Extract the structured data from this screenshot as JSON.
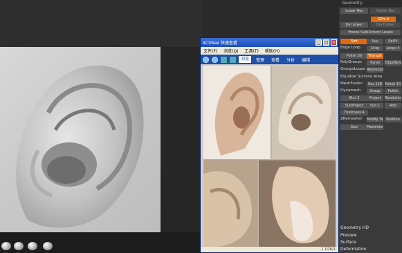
{
  "app_title": "ACDSee 快速查看",
  "acdsee": {
    "window_title": "ACDSee 快速查看",
    "menu": [
      "文件(F)",
      "浏览(Q)",
      "工具(T)",
      "帮助(H)"
    ],
    "tabs": [
      "浏览",
      "管理",
      "查看",
      "分析",
      "编辑"
    ],
    "status": "1 1/26/1"
  },
  "zbrush": {
    "panel_header": "Geometry",
    "buttons_top": [
      {
        "label": "Lower Res",
        "style": "normal"
      },
      {
        "label": "Higher Res",
        "style": "dim"
      },
      {
        "label": "SDiv 4",
        "style": "orange"
      },
      {
        "label": "Del Lower",
        "style": "normal"
      },
      {
        "label": "Del Higher",
        "style": "dim"
      },
      {
        "label": "Freeze SubDivision Levels",
        "style": "normal"
      }
    ],
    "labels": [
      {
        "text": "Smt",
        "style": "orange"
      },
      {
        "text": "Suv",
        "style": "normal"
      },
      {
        "text": "ReUV",
        "style": "normal"
      },
      {
        "text": "Edge Loop",
        "style": "label"
      },
      {
        "text": "Crisp",
        "style": "normal"
      },
      {
        "text": "Loops 4",
        "style": "normal"
      },
      {
        "text": "Polish 50",
        "style": "normal"
      },
      {
        "text": "Triangle",
        "style": "orange"
      },
      {
        "text": "PolyGroups",
        "style": "label"
      },
      {
        "text": "Panel",
        "style": "normal"
      },
      {
        "text": "EdgeBevel 1",
        "style": "normal"
      },
      {
        "text": "GroupsLoops",
        "style": "label"
      },
      {
        "text": "ReGroups",
        "style": "normal"
      },
      {
        "text": "Equalize Surface Area",
        "style": "label"
      },
      {
        "text": "MeshFusion",
        "style": "label"
      },
      {
        "text": "Res 128",
        "style": "normal"
      },
      {
        "text": "Polish 10",
        "style": "normal"
      },
      {
        "text": "Dynamesh",
        "style": "label"
      },
      {
        "text": "Group",
        "style": "normal"
      },
      {
        "text": "Polish",
        "style": "normal"
      },
      {
        "text": "Blur 2",
        "style": "normal"
      },
      {
        "text": "Project",
        "style": "normal"
      },
      {
        "text": "Resolution 128",
        "style": "normal"
      },
      {
        "text": "SubProject",
        "style": "normal"
      },
      {
        "text": "Sub 1",
        "style": "normal"
      },
      {
        "text": "Add",
        "style": "normal"
      },
      {
        "text": "Thickness 4",
        "style": "normal"
      },
      {
        "text": "ZRemesher",
        "style": "label"
      },
      {
        "text": "Modify Topology",
        "style": "normal"
      },
      {
        "text": "Position",
        "style": "normal"
      },
      {
        "text": "Size",
        "style": "normal"
      },
      {
        "text": "MeshIntegrity",
        "style": "normal"
      }
    ],
    "sections": [
      "Geometry HD",
      "Preview",
      "Surface",
      "Deformation"
    ]
  },
  "colors": {
    "accent_orange": "#e06a10",
    "xp_title": "#1f4fb5",
    "zb_panel": "#3a3a3a"
  }
}
